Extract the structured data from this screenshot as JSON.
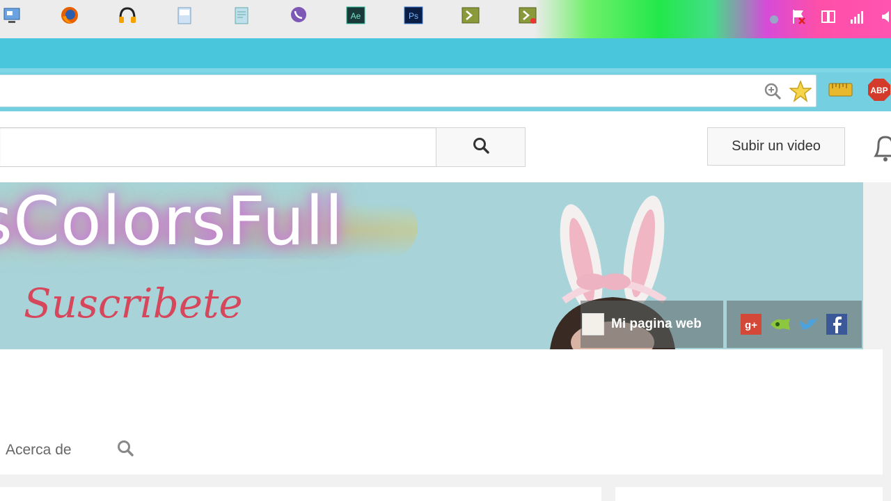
{
  "taskbar": {
    "icons": [
      "remote-desktop-icon",
      "firefox-icon",
      "headphones-icon",
      "notepad-icon",
      "document-icon",
      "viber-icon",
      "after-effects-icon",
      "photoshop-icon",
      "script-icon",
      "script-edit-icon"
    ],
    "ae_text": "Ae",
    "ps_text": "Ps",
    "tray": [
      "network-flag-icon",
      "connect-icon",
      "signal-icon"
    ]
  },
  "browser": {
    "ext_badge": "ABP"
  },
  "youtube": {
    "upload_label": "Subir un video"
  },
  "banner": {
    "title": "sColorsFull",
    "subtitle": "Suscribete",
    "web_link_label": "Mi pagina web"
  },
  "channel": {
    "tab_about": "Acerca de"
  },
  "colors": {
    "accent": "#49c5dc",
    "banner_bg": "#a7d3d9",
    "subtitle": "#d6475b"
  }
}
